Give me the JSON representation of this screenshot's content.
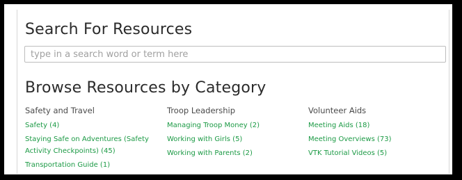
{
  "search": {
    "heading": "Search For Resources",
    "placeholder": "type in a search word or term here"
  },
  "browse": {
    "heading": "Browse Resources by Category",
    "categories": [
      {
        "title": "Safety and Travel",
        "items": [
          "Safety (4)",
          "Staying Safe on Adventures (Safety Activity Checkpoints) (45)",
          "Transportation Guide (1)"
        ]
      },
      {
        "title": "Troop Leadership",
        "items": [
          "Managing Troop Money (2)",
          "Working with Girls (5)",
          "Working with Parents (2)"
        ]
      },
      {
        "title": "Volunteer Aids",
        "items": [
          "Meeting Aids (18)",
          "Meeting Overviews (73)",
          "VTK Tutorial Videos (5)"
        ]
      }
    ]
  },
  "colors": {
    "link": "#1c9a45",
    "heading": "#2b2b2b",
    "frame": "#000000"
  }
}
